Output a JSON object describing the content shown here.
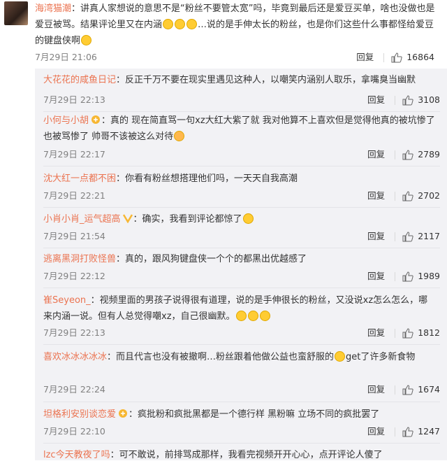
{
  "main": {
    "user": "海湾猫潮",
    "text_a": "：讲真人家想说的意思不是“粉丝不要管太宽”吗，毕竟到最后还是爱豆买单，啥也没做也是爱豆被骂。结果评论里又在内涵",
    "text_b": "…说的是手伸太长的粉丝，也是你们这些什么事都怪给爱豆的键盘侠啊",
    "time": "7月29日 21:06",
    "reply": "回复",
    "likes": "16864"
  },
  "replies": [
    {
      "user": "大花花的咸鱼日记",
      "text": "：反正千万不要在现实里遇见这种人，以嘲笑内涵别人取乐，拿嘴臭当幽默",
      "time": "7月29日 22:13",
      "reply": "回复",
      "likes": "3108"
    },
    {
      "user": "小何与小胡",
      "text": "：真的 现在简直骂一句xz大红大紫了就 我对他算不上喜欢但是觉得他真的被坑惨了也被骂惨了 帅哥不该被这么对待",
      "time": "7月29日 22:17",
      "reply": "回复",
      "likes": "2789"
    },
    {
      "user": "沈大红一点都不困",
      "text": "：你看有粉丝想搭理他们吗，一天天自我高潮",
      "time": "7月29日 22:21",
      "reply": "回复",
      "likes": "2702"
    },
    {
      "user": "小肖小肖_运气超高",
      "text": "：确实，我看到评论都惊了",
      "time": "7月29日 21:54",
      "reply": "回复",
      "likes": "2117"
    },
    {
      "user": "逃离黑洞打败怪兽",
      "text": "：真的，跟风狗键盘侠一个个的都黑出优越感了",
      "time": "7月29日 22:12",
      "reply": "回复",
      "likes": "1989"
    },
    {
      "user": "崔Seyeon_",
      "text": "：视频里面的男孩子说得很有道理，说的是手伸很长的粉丝，又没说xz怎么怎么，哪来内涵一说。但有人总觉得嘲xz，自己很幽默。",
      "time": "7月29日 22:13",
      "reply": "回复",
      "likes": "1812"
    },
    {
      "user": "喜欢冰冰冰冰冰",
      "text": "：而且代言也没有被撤啊…粉丝跟着他做公益也蛮舒服的",
      "text_b": "get了许多新食物",
      "time": "7月29日 22:24",
      "reply": "回复",
      "likes": "1674"
    },
    {
      "user": "坦格利安别谈恋爱",
      "text": "：疯批粉和疯批黑都是一个德行样 黑粉嘛 立场不同的疯批罢了",
      "time": "7月29日 22:10",
      "reply": "回复",
      "likes": "1247"
    },
    {
      "user": "lzc今天教夜了吗",
      "text": "：可不敢说，前排骂成那样，我看完视频开开心心，点开评论人傻了",
      "time": "",
      "reply": "",
      "likes": ""
    }
  ],
  "colors": {
    "username": "#eb7350",
    "meta": "#808080",
    "reply_bg": "#f2f2f5"
  }
}
